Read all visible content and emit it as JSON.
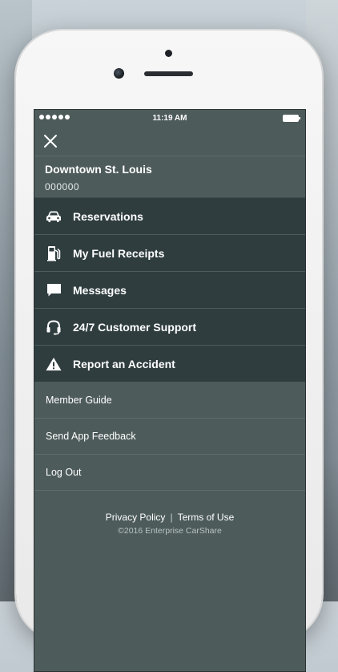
{
  "status_bar": {
    "time": "11:19 AM"
  },
  "menu": {
    "close_icon": "close-icon",
    "account": {
      "name": "Downtown St. Louis",
      "id": "000000"
    },
    "primary_items": [
      {
        "label": "Reservations",
        "icon": "car-icon"
      },
      {
        "label": "My Fuel Receipts",
        "icon": "fuel-pump-icon"
      },
      {
        "label": "Messages",
        "icon": "message-bubble-icon"
      },
      {
        "label": "24/7 Customer Support",
        "icon": "headset-icon"
      },
      {
        "label": "Report an Accident",
        "icon": "warning-icon"
      }
    ],
    "secondary_items": [
      {
        "label": "Member Guide"
      },
      {
        "label": "Send App Feedback"
      },
      {
        "label": "Log Out"
      }
    ]
  },
  "footer": {
    "privacy_label": "Privacy Policy",
    "separator": "|",
    "terms_label": "Terms of Use",
    "copyright": "©2016 Enterprise CarShare"
  },
  "colors": {
    "menu_bg": "#4e5b5b",
    "primary_item_bg": "#2f3d3f",
    "text": "#ffffff"
  }
}
